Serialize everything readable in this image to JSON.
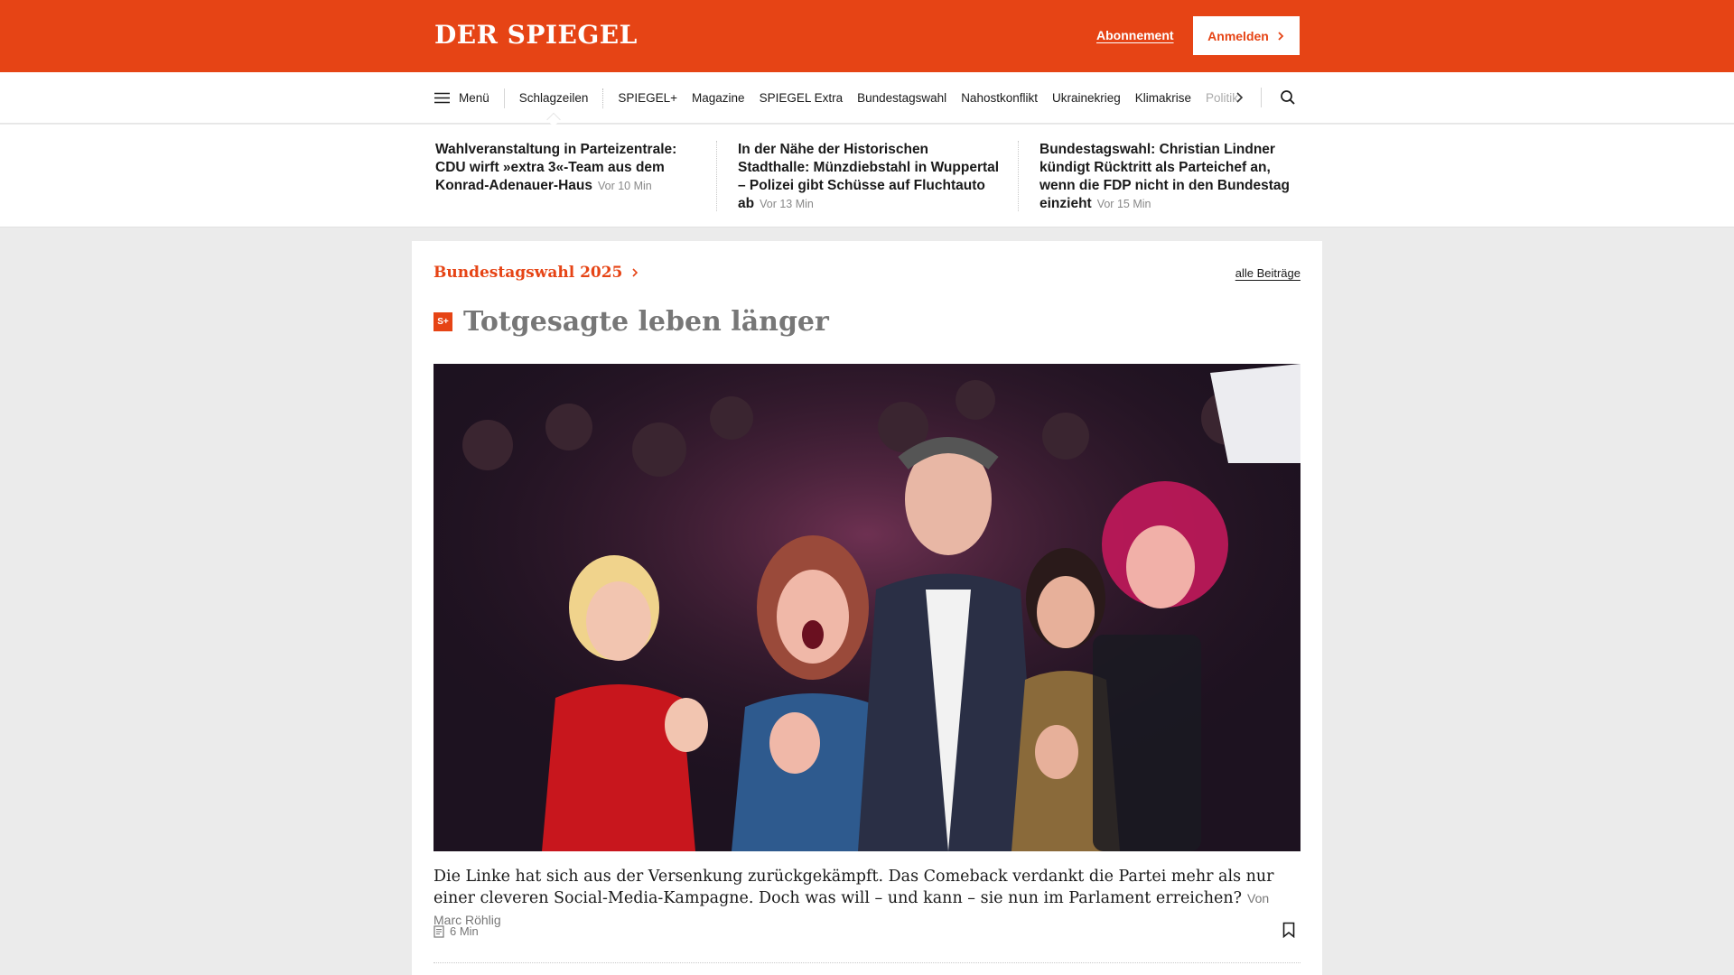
{
  "header": {
    "logo": "DER SPIEGEL",
    "subscription_label": "Abonnement",
    "login_label": "Anmelden",
    "brand_color": "#e64415"
  },
  "nav": {
    "menu_label": "Menü",
    "items": [
      "Schlagzeilen",
      "SPIEGEL+",
      "Magazine",
      "SPIEGEL Extra",
      "Bundestagswahl",
      "Nahostkonflikt",
      "Ukrainekrieg",
      "Klimakrise",
      "Politik"
    ],
    "active": "Schlagzeilen"
  },
  "headlines": [
    {
      "text": "Wahlveranstaltung in Parteizentrale: CDU wirft »extra 3«-Team aus dem Konrad-Adenauer-Haus",
      "time": "Vor 10 Min"
    },
    {
      "text": "In der Nähe der Historischen Stadthalle: Münzdiebstahl in Wuppertal – Polizei gibt Schüsse auf Fluchtauto ab",
      "time": "Vor 13 Min"
    },
    {
      "text": "Bundestagswahl: Christian Lindner kündigt Rücktritt als Parteichef an, wenn die FDP nicht in den Bundestag einzieht",
      "time": "Vor 15 Min"
    }
  ],
  "section": {
    "kicker": "Bundestagswahl 2025",
    "all_label": "alle Beiträge"
  },
  "article": {
    "badge": "S+",
    "title": "Totgesagte leben länger",
    "teaser": "Die Linke hat sich aus der Versenkung zurückgekämpft. Das Comeback verdankt die Partei mehr als nur einer cleveren Social-Media-Kampagne. Doch was will – und kann – sie nun im Parlament erreichen?",
    "author": "Von Marc Röhlig",
    "read_time": "6 Min"
  }
}
